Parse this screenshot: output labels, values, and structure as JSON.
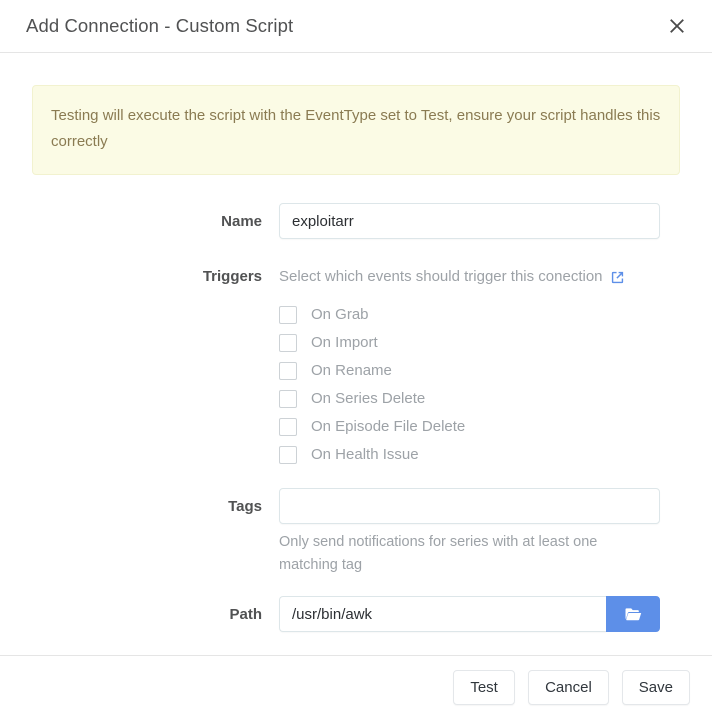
{
  "header": {
    "title": "Add Connection - Custom Script",
    "close_icon": "close-icon"
  },
  "alert": {
    "text": "Testing will execute the script with the EventType set to Test, ensure your script handles this correctly",
    "bg_color": "#fbfbe5",
    "border_color": "#f2f2cf",
    "text_color": "#8a7b52"
  },
  "form": {
    "name": {
      "label": "Name",
      "value": "exploitarr",
      "placeholder": ""
    },
    "triggers": {
      "label": "Triggers",
      "description": "Select which events should trigger this conection",
      "link_icon": "external-link-icon",
      "link_color": "#5d8fe8",
      "options": [
        {
          "label": "On Grab",
          "checked": false
        },
        {
          "label": "On Import",
          "checked": false
        },
        {
          "label": "On Rename",
          "checked": false
        },
        {
          "label": "On Series Delete",
          "checked": false
        },
        {
          "label": "On Episode File Delete",
          "checked": false
        },
        {
          "label": "On Health Issue",
          "checked": false
        }
      ]
    },
    "tags": {
      "label": "Tags",
      "value": "",
      "placeholder": "",
      "help": "Only send notifications for series with at least one matching tag"
    },
    "path": {
      "label": "Path",
      "value": "/usr/bin/awk",
      "placeholder": "",
      "browse_icon": "folder-open-icon",
      "browse_color": "#5d8fe8"
    }
  },
  "footer": {
    "test_label": "Test",
    "cancel_label": "Cancel",
    "save_label": "Save"
  }
}
